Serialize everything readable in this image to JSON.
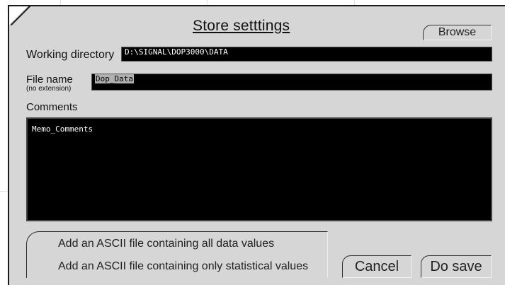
{
  "dialog": {
    "title": "Store setttings",
    "browse_label": "Browse",
    "working_directory": {
      "label": "Working directory",
      "value": "D:\\SIGNAL\\DOP3000\\DATA"
    },
    "file_name": {
      "label": "File name",
      "sublabel": "(no extension)",
      "value": "Dop_Data"
    },
    "comments": {
      "label": "Comments",
      "value": "Memo_Comments"
    },
    "options": [
      {
        "label": "Add an ASCII file containing all data values"
      },
      {
        "label": "Add an ASCII file containing  only statistical values"
      }
    ],
    "cancel_label": "Cancel",
    "save_label": "Do save"
  }
}
